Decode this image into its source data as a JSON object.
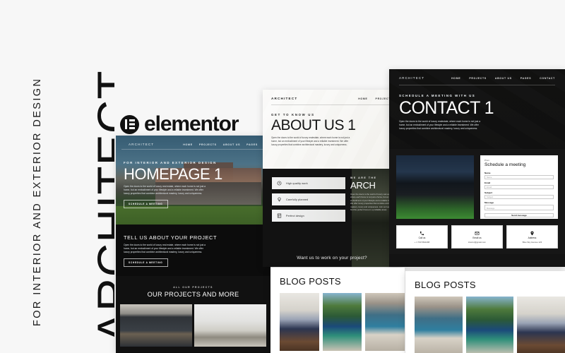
{
  "banner": {
    "title": "ARCHITECT",
    "subtitle": "FOR INTERIOR AND EXTERIOR DESIGN"
  },
  "branding": {
    "logo_word": "elementor",
    "logo_icon": "elementor-logo-icon",
    "accent_dark": "#111111",
    "page_bg": "#f7f7f7"
  },
  "homepage_mock": {
    "brand": "ARCHITECT",
    "nav": [
      "HOME",
      "PROJECTS",
      "ABOUT US",
      "PAGES"
    ],
    "hero": {
      "eyebrow": "FOR INTERIOR AND EXTERIOR DESIGN",
      "title": "HOMEPAGE 1",
      "paragraph": "Open the doors to the world of luxury real estate, where each home is not just a home, but an embodiment of your lifestyle and a reliable investment. We offer luxury properties that combine architectural mastery, luxury and uniqueness.",
      "button": "SCHEDULE A MEETING"
    },
    "project_section": {
      "heading": "TELL US ABOUT YOUR PROJECT",
      "paragraph": "Open the doors to the world of luxury real estate, where each home is not just a home, but an embodiment of your lifestyle and a reliable investment. We offer luxury properties that combine architectural mastery, luxury and uniqueness.",
      "button": "SCHEDULE A MEETING"
    },
    "projects_section": {
      "eyebrow": "ALL OUR PROJECTS",
      "heading": "OUR PROJECTS AND MORE"
    }
  },
  "about_mock": {
    "brand": "ARCHITECT",
    "nav": [
      "HOME",
      "PROJECTS"
    ],
    "hero": {
      "eyebrow": "GET TO KNOW US",
      "title": "ABOUT US 1",
      "paragraph": "Open the doors to the world of luxury realestate, where each home is not just a home, but an embodiment of your lifestyle and a reliable investment. We offer luxury properties that combine architectural mastery, luxury and uniqueness."
    },
    "features": [
      {
        "icon": "clock-icon",
        "label": "High quality work"
      },
      {
        "icon": "lightbulb-icon",
        "label": "Carefully planned"
      },
      {
        "icon": "blueprint-icon",
        "label": "Perfect design"
      }
    ],
    "right_block": {
      "eyebrow": "WE ARE THE",
      "title": "ARCH",
      "paragraph": "Open the doors to the world of luxury real estate, where each home is not just a home, but an embodiment of your lifestyle and a reliable investment. We offer luxury properties that combine architectural mastery, luxury and uniqueness. Join our team and find the perfect home in a profitable asset."
    },
    "cta": "Want us to work on your project?"
  },
  "contact_mock": {
    "brand": "ARCHITECT",
    "nav": [
      "HOME",
      "PROJECTS",
      "ABOUT US",
      "PAGES",
      "CONTACT"
    ],
    "hero": {
      "eyebrow": "SCHEDULE A MEETING WITH US",
      "title": "CONTACT 1",
      "paragraph": "Open the doors to the world of luxury realestate, where each home is not just a home, but an embodiment of your lifestyle and a reliable investment. We offer luxury properties that combine architectural mastery, luxury and uniqueness."
    },
    "form": {
      "eyebrow": "Plan",
      "title": "Schedule a meeting",
      "fields": [
        {
          "label": "Name",
          "placeholder": "Name",
          "value": ""
        },
        {
          "label": "Email",
          "placeholder": "Email",
          "value": ""
        },
        {
          "label": "Subject",
          "placeholder": "Subject",
          "value": ""
        },
        {
          "label": "Message",
          "placeholder": "Message",
          "value": ""
        }
      ],
      "submit": "Send message"
    },
    "contact_cards": [
      {
        "icon": "phone-icon",
        "title": "Call us",
        "value": "+ 1 760 5811298"
      },
      {
        "icon": "mail-icon",
        "title": "Email us",
        "value": "interior@gmail.com"
      },
      {
        "icon": "pin-icon",
        "title": "Address",
        "value": "Blue Sky Avenue 123"
      }
    ]
  },
  "blog_left": {
    "heading": "BLOG POSTS",
    "thumbs": [
      "blog-thumb-interior",
      "blog-thumb-pool",
      "blog-thumb-palms"
    ]
  },
  "blog_right": {
    "heading": "BLOG POSTS",
    "thumbs": [
      "blog-thumb-pool",
      "blog-thumb-palms",
      "blog-thumb-dining"
    ]
  }
}
